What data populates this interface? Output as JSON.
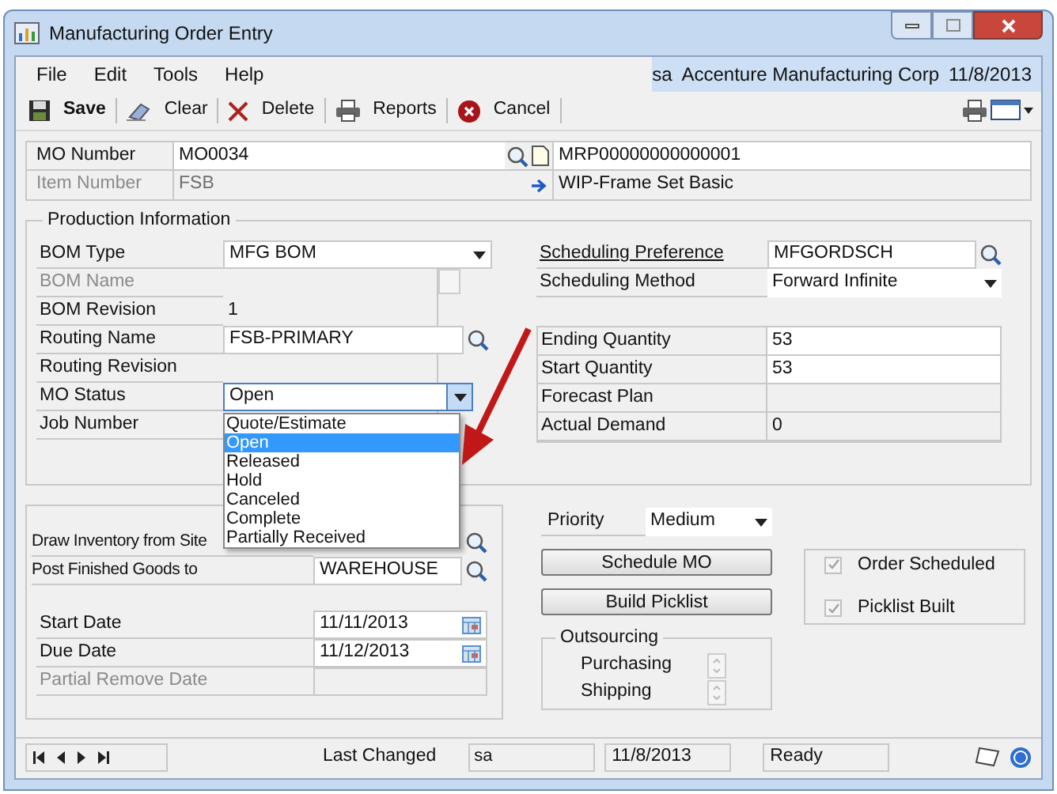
{
  "window": {
    "title": "Manufacturing Order Entry"
  },
  "menu": {
    "items": [
      "File",
      "Edit",
      "Tools",
      "Help"
    ],
    "user": "sa",
    "company": "Accenture Manufacturing Corp",
    "date": "11/8/2013"
  },
  "toolbar": {
    "buttons": [
      {
        "kind": "save",
        "label": "Save",
        "default": true
      },
      {
        "kind": "clear",
        "label": "Clear",
        "default": false
      },
      {
        "kind": "delete",
        "label": "Delete",
        "default": false
      },
      {
        "kind": "reports",
        "label": "Reports",
        "default": false
      },
      {
        "kind": "cancel",
        "label": "Cancel",
        "default": false
      }
    ]
  },
  "header": {
    "mo_number": {
      "label": "MO Number",
      "value": "MO0034",
      "document": "MRP00000000000001"
    },
    "item_number": {
      "label": "Item Number",
      "value": "FSB",
      "description": "WIP-Frame Set Basic",
      "disabled": true
    }
  },
  "production_info": {
    "title": "Production Information",
    "left_fields": [
      {
        "kind": "dropdown",
        "label": "BOM Type",
        "value": "MFG BOM",
        "disabled": false
      },
      {
        "kind": "disabled",
        "label": "BOM Name",
        "disabled": true
      },
      {
        "kind": "text",
        "label": "BOM Revision",
        "value": "1",
        "disabled": false
      },
      {
        "kind": "lookup",
        "label": "Routing Name",
        "value": "FSB-PRIMARY",
        "disabled": false
      },
      {
        "kind": "text",
        "label": "Routing Revision",
        "disabled": false
      },
      {
        "kind": "status",
        "label": "MO Status",
        "value": "Open",
        "disabled": false
      },
      {
        "kind": "text",
        "label": "Job Number",
        "disabled": false
      }
    ],
    "scheduling": [
      {
        "kind": "lookup",
        "label": "Scheduling Preference",
        "value": "MFGORDSCH",
        "link": true
      },
      {
        "kind": "dropdown",
        "label": "Scheduling Method",
        "value": "Forward Infinite",
        "link": false
      }
    ],
    "quantities": [
      {
        "label": "Ending Quantity",
        "value": "53",
        "editable": true
      },
      {
        "label": "Start Quantity",
        "value": "53",
        "editable": true
      },
      {
        "label": "Forecast Plan",
        "editable": false
      },
      {
        "label": "Actual Demand",
        "value": "0",
        "editable": false
      }
    ]
  },
  "mo_status_options": [
    {
      "label": "Quote/Estimate",
      "selected": false
    },
    {
      "label": "Open",
      "selected": true
    },
    {
      "label": "Released",
      "selected": false
    },
    {
      "label": "Hold",
      "selected": false
    },
    {
      "label": "Canceled",
      "selected": false
    },
    {
      "label": "Complete",
      "selected": false
    },
    {
      "label": "Partially Received",
      "selected": false
    }
  ],
  "sites": [
    {
      "label": "Draw Inventory from Site"
    },
    {
      "label": "Post Finished Goods to",
      "value": "WAREHOUSE"
    }
  ],
  "dates": [
    {
      "label": "Start Date",
      "value": "11/11/2013",
      "disabled": false
    },
    {
      "label": "Due Date",
      "value": "11/12/2013",
      "disabled": false
    },
    {
      "label": "Partial Remove Date",
      "disabled": true
    }
  ],
  "priority": {
    "label": "Priority",
    "value": "Medium"
  },
  "actions": [
    "Schedule MO",
    "Build Picklist"
  ],
  "checks": [
    {
      "label": "Order Scheduled",
      "checked": true
    },
    {
      "label": "Picklist Built",
      "checked": true
    }
  ],
  "outsourcing": {
    "title": "Outsourcing",
    "items": [
      "Purchasing",
      "Shipping"
    ]
  },
  "status_bar": {
    "last_changed_label": "Last Changed",
    "user": "sa",
    "date": "11/8/2013",
    "status": "Ready"
  }
}
